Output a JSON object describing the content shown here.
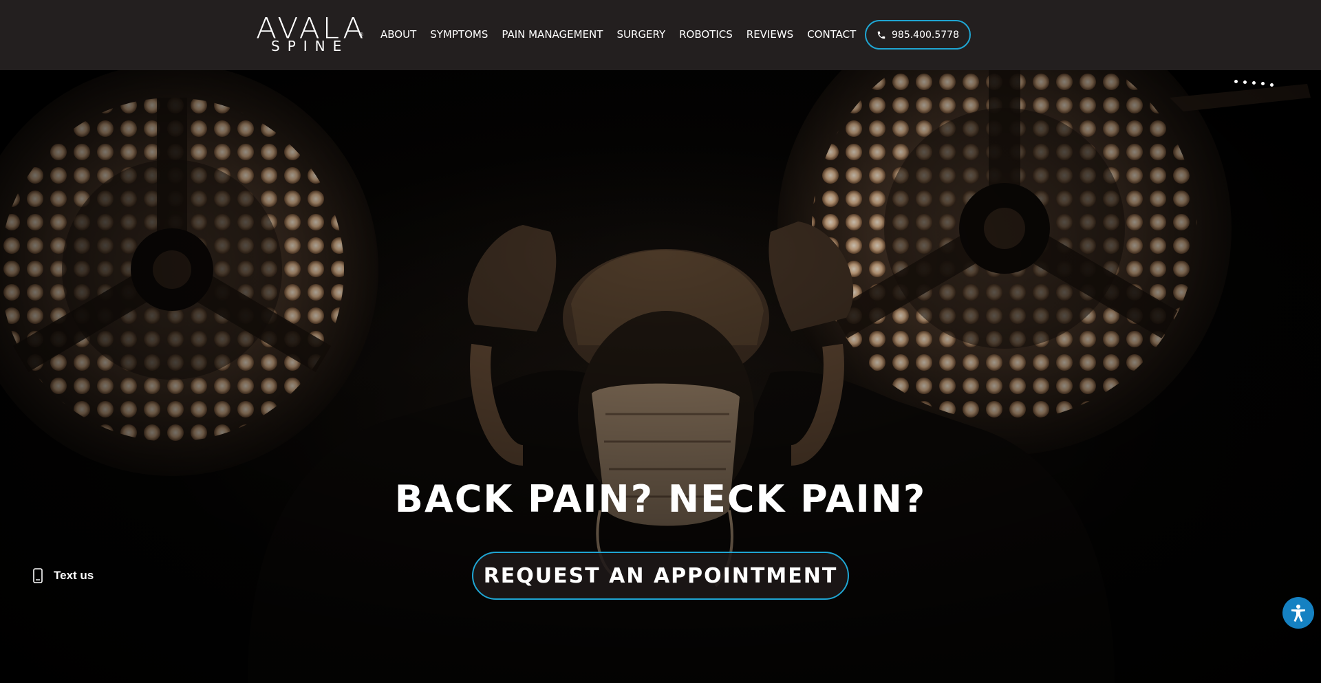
{
  "brand": {
    "logo_top": "AVALA",
    "logo_bottom": "SPINE",
    "logo_reg": "®",
    "accent_color": "#1fa6d3"
  },
  "nav": {
    "items": [
      {
        "label": "ABOUT"
      },
      {
        "label": "SYMPTOMS"
      },
      {
        "label": "PAIN MANAGEMENT"
      },
      {
        "label": "SURGERY"
      },
      {
        "label": "ROBOTICS"
      },
      {
        "label": "REVIEWS"
      },
      {
        "label": "CONTACT"
      }
    ],
    "phone": "985.400.5778",
    "phone_icon": "phone-icon"
  },
  "hero": {
    "headline": "BACK PAIN? NECK PAIN?",
    "cta_label": "REQUEST AN APPOINTMENT",
    "slider_dots": 5
  },
  "widgets": {
    "text_us_label": "Text us",
    "text_us_icon": "mobile-phone-icon",
    "accessibility_icon": "accessibility-icon",
    "accessibility_color": "#1581c2"
  }
}
